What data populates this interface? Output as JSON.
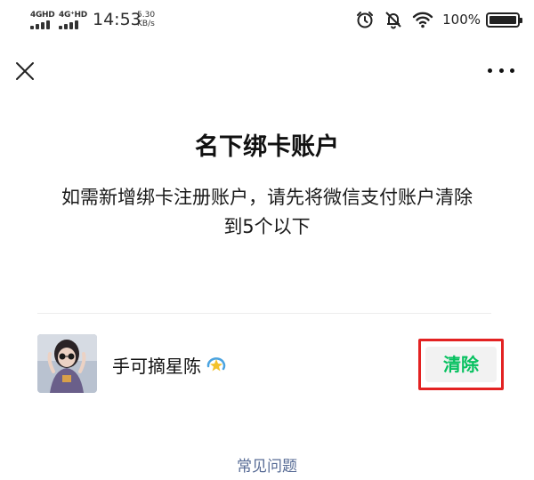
{
  "status_bar": {
    "signal_1_label": "4GHD",
    "signal_2_label": "4G⁺HD",
    "time": "14:53",
    "net_speed_value": "5.30",
    "net_speed_unit": "KB/s",
    "battery_text": "100%",
    "icons": [
      "alarm-icon",
      "mute-bell-icon",
      "wifi-icon",
      "battery-icon"
    ]
  },
  "nav": {
    "close_icon": "close-icon",
    "more_icon": "more-dots-icon"
  },
  "page": {
    "title": "名下绑卡账户",
    "description_line1": "如需新增绑卡注册账户，请先将微信支付账户清除",
    "description_line2": "到5个以下"
  },
  "account": {
    "nickname": "手可摘星陈",
    "nickname_emoji": "dizzy-star-emoji",
    "clear_label": "清除"
  },
  "footer": {
    "faq_label": "常见问题"
  },
  "colors": {
    "accent_green": "#07c160",
    "link_blue": "#576b95",
    "highlight_red": "#e32222"
  }
}
